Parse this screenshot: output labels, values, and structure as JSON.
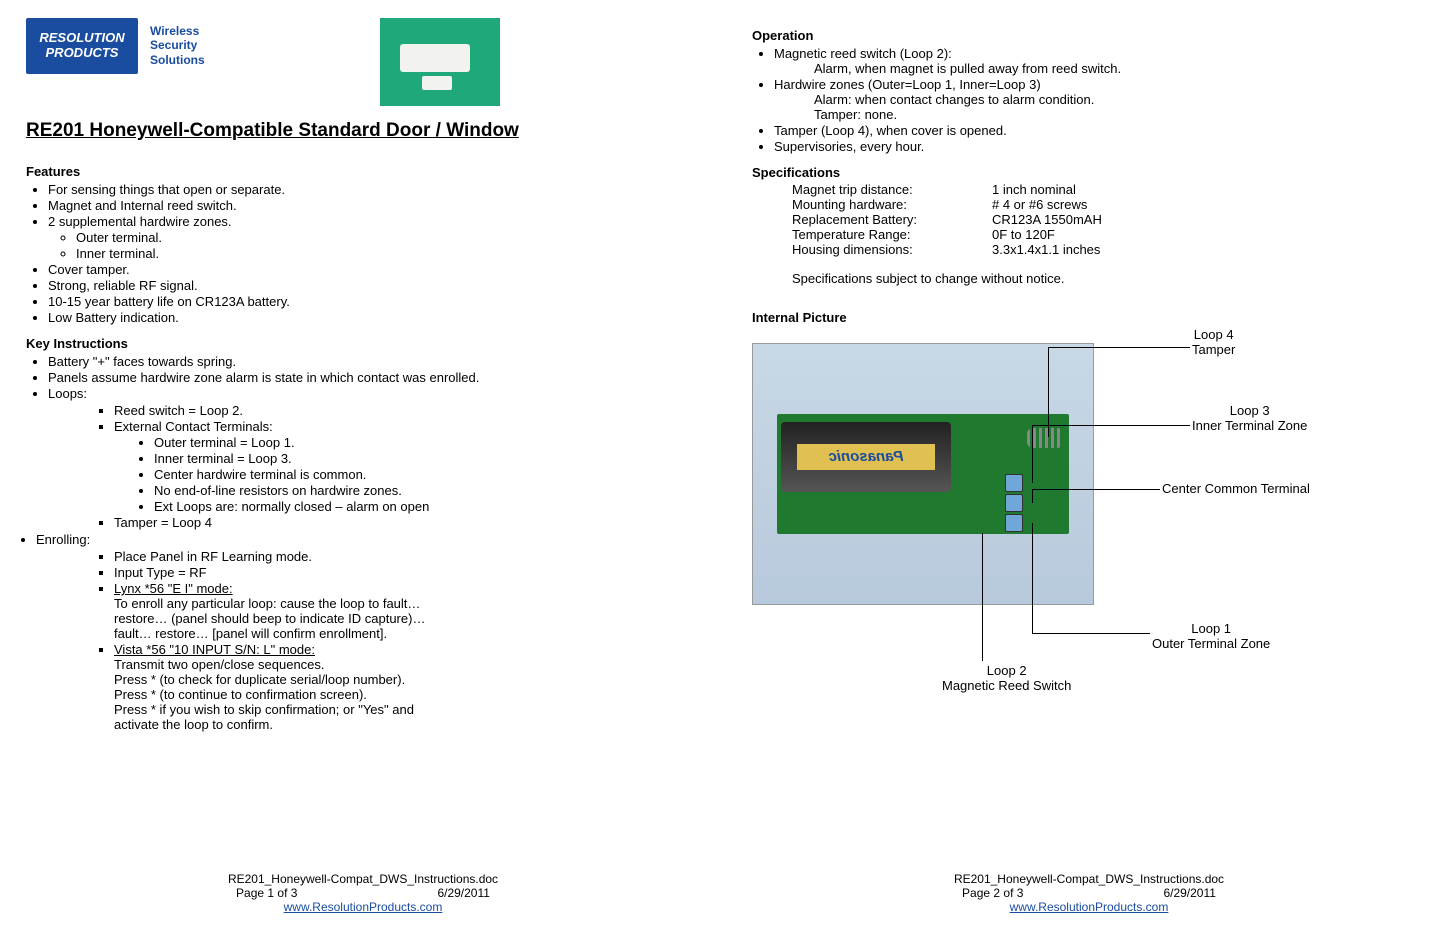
{
  "logo": {
    "line1": "RESOLUTION",
    "line2": "PRODUCTS"
  },
  "tagline": "Wireless\nSecurity\nSolutions",
  "title": "RE201 Honeywell-Compatible Standard Door / Window",
  "features_heading": "Features",
  "features": [
    "For sensing things that open or separate.",
    "Magnet and Internal reed switch.",
    "2 supplemental hardwire zones.",
    "Cover tamper.",
    "Strong, reliable RF signal.",
    "10-15 year battery life on CR123A battery.",
    "Low Battery indication."
  ],
  "features_sub": [
    "Outer terminal.",
    "Inner terminal."
  ],
  "key_heading": "Key Instructions",
  "key_top": [
    "Battery \"+\" faces towards spring.",
    "Panels assume hardwire zone alarm is state in which contact was enrolled.",
    "Loops:"
  ],
  "loops_sq": [
    "Reed switch = Loop 2.",
    "External Contact Terminals:",
    "Tamper = Loop 4"
  ],
  "loops_inner": [
    "Outer terminal = Loop 1.",
    "Inner terminal = Loop 3.",
    "Center hardwire terminal is common.",
    "No end-of-line resistors on hardwire zones.",
    "Ext Loops are: normally closed – alarm on open"
  ],
  "enrolling_label": "Enrolling:",
  "enroll_sq": [
    "Place Panel in RF Learning mode.",
    "Input Type = RF"
  ],
  "enroll_lynx_title": "Lynx *56  \"E   I\"  mode:",
  "enroll_lynx_body": "To enroll any particular loop: cause the loop to fault…\nrestore… (panel should beep to indicate ID capture)…\nfault… restore… [panel will confirm enrollment].",
  "enroll_vista_title": "Vista  *56  \"10 INPUT S/N: L\" mode:",
  "enroll_vista_body": "Transmit two open/close sequences.\nPress * (to check for duplicate serial/loop number).\nPress * (to continue to confirmation screen).\nPress * if you wish to skip confirmation; or \"Yes\" and\nactivate the loop to confirm.",
  "operation_heading": "Operation",
  "op_reed_label": "Magnetic reed switch (Loop 2):",
  "op_reed_sub": "Alarm, when magnet is pulled away from reed switch.",
  "op_hw_label": "Hardwire zones (Outer=Loop 1, Inner=Loop 3)",
  "op_hw_sub1": "Alarm: when contact changes to alarm condition.",
  "op_hw_sub2": "Tamper: none.",
  "op_tamper": "Tamper (Loop 4), when cover is opened.",
  "op_super": "Supervisories, every hour.",
  "spec_heading": "Specifications",
  "specs": [
    {
      "label": "Magnet trip distance:",
      "value": "1 inch nominal"
    },
    {
      "label": "Mounting hardware:",
      "value": "# 4 or #6 screws"
    },
    {
      "label": "Replacement Battery:",
      "value": "CR123A 1550mAH"
    },
    {
      "label": "Temperature Range:",
      "value": "0F to 120F"
    },
    {
      "label": "Housing dimensions:",
      "value": "3.3x1.4x1.1 inches"
    }
  ],
  "spec_note": "Specifications subject to change without notice.",
  "internal_heading": "Internal Picture",
  "battery_brand": "Panasonic",
  "callouts": {
    "loop4": "Loop 4\nTamper",
    "loop3": "Loop 3\nInner Terminal Zone",
    "center": "Center Common Terminal",
    "loop1": "Loop 1\nOuter Terminal Zone",
    "loop2": "Loop 2\nMagnetic Reed Switch"
  },
  "footer": {
    "filename": "RE201_Honeywell-Compat_DWS_Instructions.doc",
    "page1": "Page 1 of 3",
    "page2": "Page 2 of 3",
    "date": "6/29/2011",
    "url": "www.ResolutionProducts.com"
  }
}
